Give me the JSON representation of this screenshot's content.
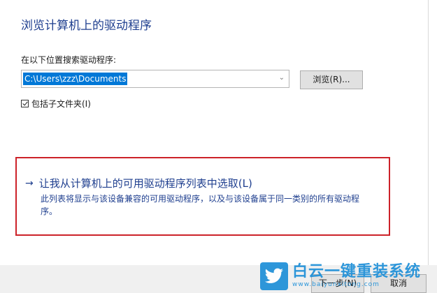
{
  "dialog": {
    "heading": "浏览计算机上的驱动程序",
    "search_label": "在以下位置搜索驱动程序:",
    "path_value": "C:\\Users\\zzz\\Documents",
    "browse_label": "浏览(R)...",
    "include_subfolders_label": "包括子文件夹(I)",
    "include_subfolders_checked": true,
    "pick_option": {
      "title": "让我从计算机上的可用驱动程序列表中选取(L)",
      "description": "此列表将显示与该设备兼容的可用驱动程序，以及与该设备属于同一类别的所有驱动程序。"
    },
    "next_label": "下一步(N)",
    "cancel_label": "取消"
  },
  "watermark": {
    "title": "白云一键重装系统",
    "url": "www.baiyunxitong.com",
    "icon": "twitter-bird-icon"
  },
  "colors": {
    "heading": "#1f3f8f",
    "highlight": "#0078d7",
    "red_border": "#cc2229",
    "watermark": "#1d8fd8"
  }
}
